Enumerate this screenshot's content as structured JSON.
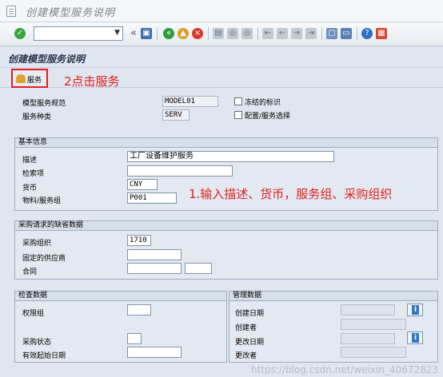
{
  "window": {
    "title": "创建模型服务说明"
  },
  "toolbar": {
    "icons": [
      "check-icon",
      "save-icon",
      "back-icon",
      "exit-icon",
      "cancel-icon",
      "print-icon",
      "find-icon",
      "find-next-icon",
      "first-page-icon",
      "prev-page-icon",
      "next-page-icon",
      "last-page-icon",
      "new-session-icon",
      "shortcut-icon",
      "help-icon",
      "layout-icon"
    ],
    "collapse_glyph": "«"
  },
  "screen": {
    "title": "创建模型服务说明",
    "service_button": "服务",
    "annotation_click": "2点击服务",
    "annotation_input": "1.输入描述、货币，服务组、采购组织"
  },
  "header": {
    "spec_label": "模型服务规范",
    "spec_value": "MODEL01",
    "type_label": "服务种类",
    "type_value": "SERV",
    "frozen_label": "冻结的标识",
    "config_label": "配置/服务选择"
  },
  "basic": {
    "title": "基本信息",
    "desc_label": "描述",
    "desc_value": "工厂设备维护服务",
    "search_label": "检索项",
    "search_value": "",
    "currency_label": "货币",
    "currency_value": "CNY",
    "group_label": "物料/服务组",
    "group_value": "P001"
  },
  "purchase": {
    "title": "采购请求的缺省数据",
    "org_label": "采购组织",
    "org_value": "1710",
    "vendor_label": "固定的供应商",
    "vendor_value": "",
    "contract_label": "合同",
    "contract_value": "",
    "contract_item_value": ""
  },
  "check": {
    "title": "检查数据",
    "auth_label": "权限组",
    "auth_value": "",
    "status_label": "采购状态",
    "status_value": "",
    "valid_label": "有效起始日期",
    "valid_value": ""
  },
  "admin": {
    "title": "管理数据",
    "created_on_label": "创建日期",
    "created_by_label": "创建者",
    "changed_on_label": "更改日期",
    "changed_by_label": "更改者",
    "info_glyph": "i"
  },
  "watermark": "https://blog.csdn.net/weixin_40672823"
}
